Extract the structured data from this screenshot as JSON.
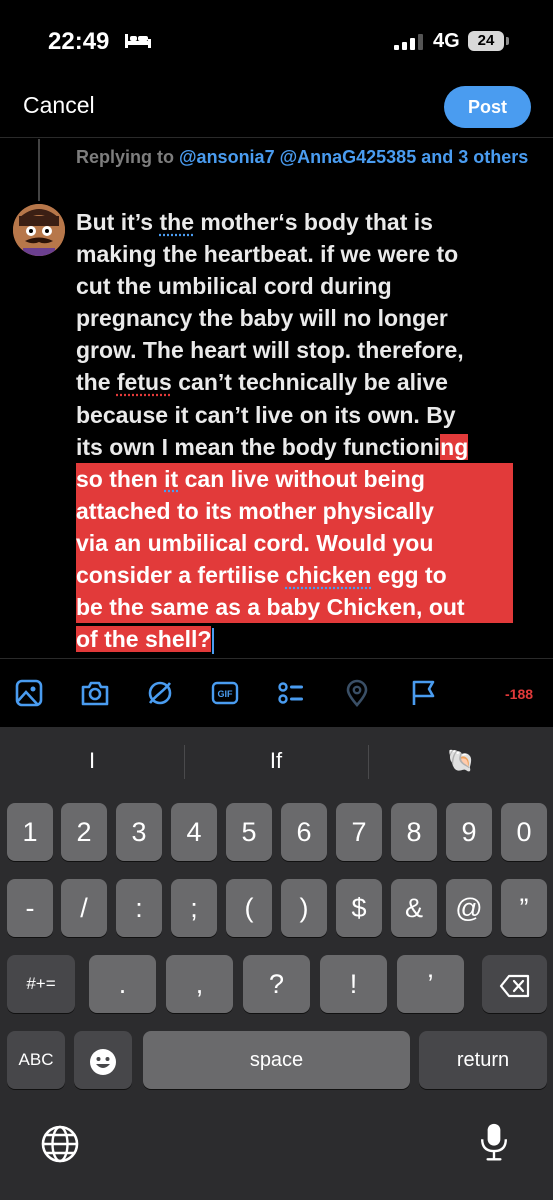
{
  "status_bar": {
    "time": "22:49",
    "network": "4G",
    "battery": "24"
  },
  "header": {
    "cancel_label": "Cancel",
    "post_label": "Post"
  },
  "reply_context": {
    "prefix": "Replying to ",
    "mentions": "@ansonia7 @AnnaG425385 and 3 others"
  },
  "compose": {
    "lines": [
      [
        "But it’s ",
        "the",
        " mother‘s body that is"
      ],
      [
        "making the heartbeat. if we were to"
      ],
      [
        "cut the umbilical cord during"
      ],
      [
        "pregnancy the baby will no longer"
      ],
      [
        "grow. The heart will stop. therefore,"
      ],
      [
        "the ",
        "fetus",
        " can’t technically be alive"
      ],
      [
        "because it can’t live on its own. By"
      ],
      [
        "its own I mean the body functioni",
        "ng"
      ],
      [
        "so then ",
        "it",
        " can live without being"
      ],
      [
        "attached to its mother physically"
      ],
      [
        "via an umbilical cord. Would you"
      ],
      [
        "consider a fertilise ",
        "chicken",
        " egg to"
      ],
      [
        "be the same as a baby Chicken, out"
      ],
      [
        "of the shell?"
      ]
    ]
  },
  "toolbar": {
    "icons": [
      "image-icon",
      "camera-icon",
      "gif-selector-icon",
      "gif-icon",
      "poll-icon",
      "location-icon",
      "flag-icon"
    ],
    "gif_label": "GIF",
    "char_count": "-188",
    "accent": "#4a9cf0",
    "warning": "#e23a3a"
  },
  "keyboard": {
    "suggestions": [
      "I",
      "If",
      "🐚"
    ],
    "row1": [
      "1",
      "2",
      "3",
      "4",
      "5",
      "6",
      "7",
      "8",
      "9",
      "0"
    ],
    "row2": [
      "-",
      "/",
      ":",
      ";",
      "(",
      ")",
      "$",
      "&",
      "@",
      "”"
    ],
    "row3": [
      ".",
      ",",
      "?",
      "!",
      "’"
    ],
    "symbols_key": "#+=",
    "abc_key": "ABC",
    "space_key": "space",
    "return_key": "return"
  }
}
